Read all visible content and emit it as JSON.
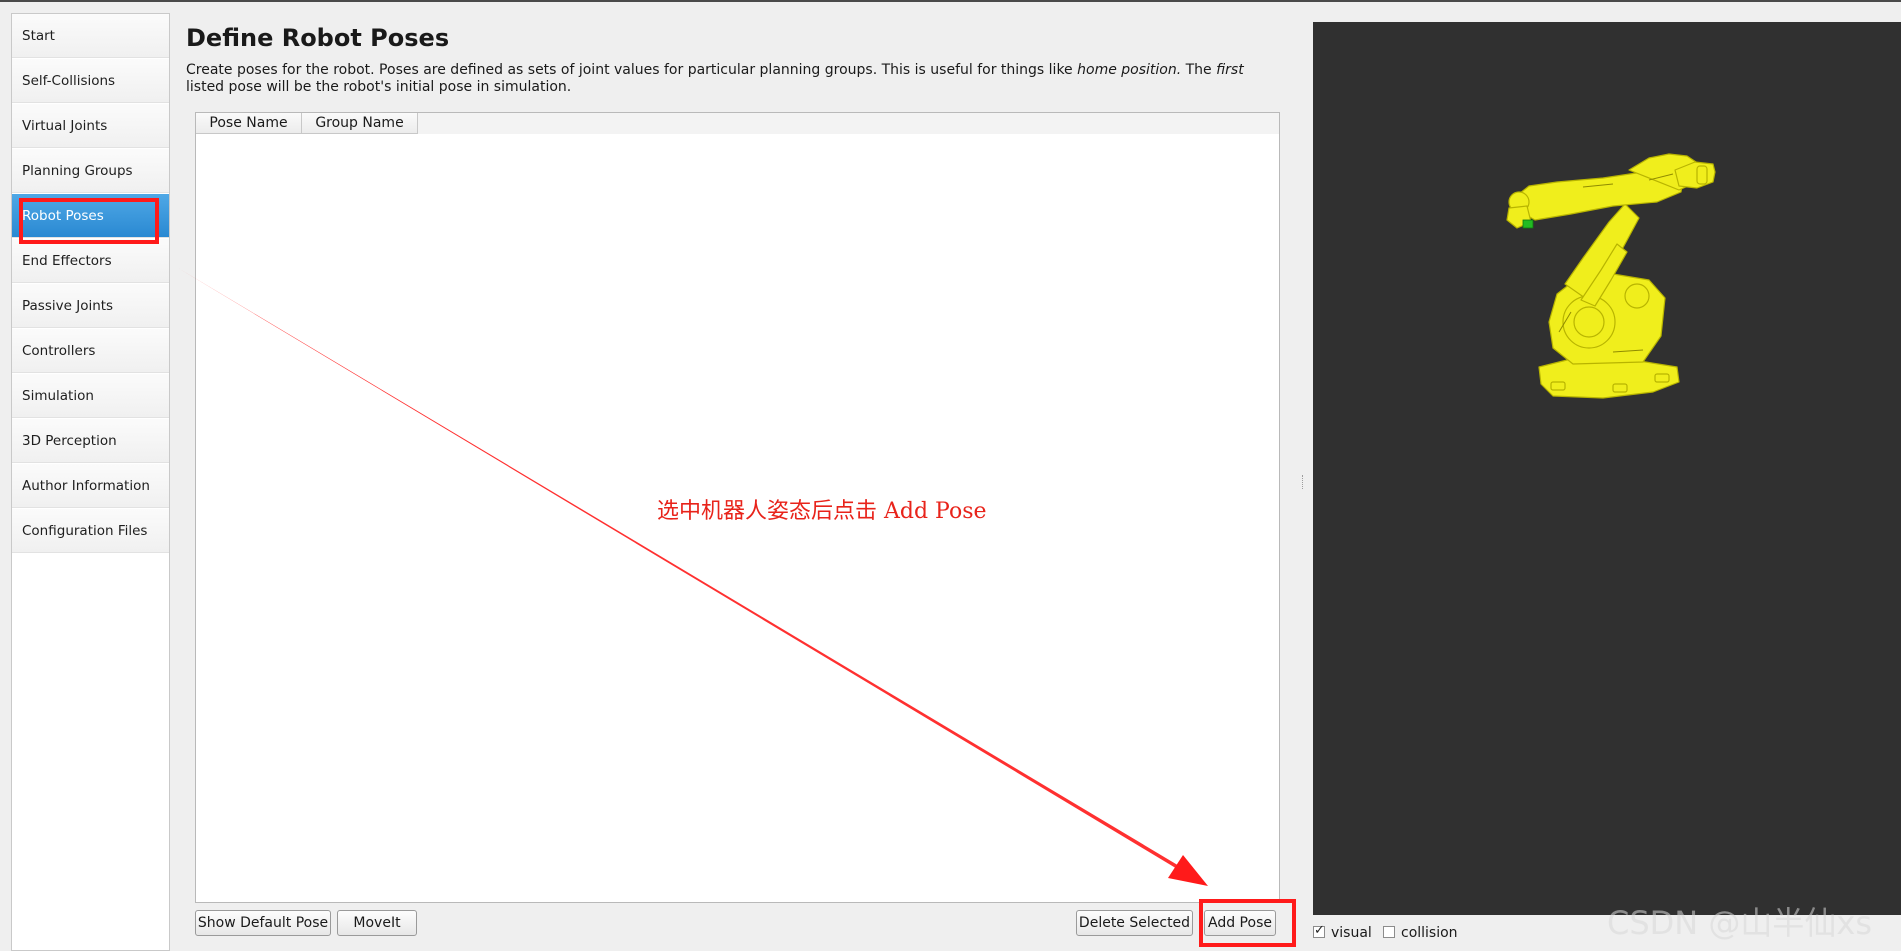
{
  "sidebar": {
    "items": [
      {
        "label": "Start"
      },
      {
        "label": "Self-Collisions"
      },
      {
        "label": "Virtual Joints"
      },
      {
        "label": "Planning Groups"
      },
      {
        "label": "Robot Poses",
        "active": true
      },
      {
        "label": "End Effectors"
      },
      {
        "label": "Passive Joints"
      },
      {
        "label": "Controllers"
      },
      {
        "label": "Simulation"
      },
      {
        "label": "3D Perception"
      },
      {
        "label": "Author Information"
      },
      {
        "label": "Configuration Files"
      }
    ]
  },
  "main": {
    "title": "Define Robot Poses",
    "description": {
      "part1": "Create poses for the robot. Poses are defined as sets of joint values for particular planning groups. This is useful for things like ",
      "em1": "home position.",
      "part2": " The ",
      "em2": "first",
      "part3": " listed pose will be the robot's initial pose in simulation."
    },
    "table": {
      "columns": [
        "Pose Name",
        "Group Name"
      ],
      "rows": []
    },
    "buttons": {
      "show_default_pose": "Show Default Pose",
      "moveit": "MoveIt",
      "delete_selected": "Delete Selected",
      "add_pose": "Add Pose"
    }
  },
  "viewer": {
    "visual_label": "visual",
    "visual_checked": true,
    "collision_label": "collision",
    "collision_checked": false
  },
  "annotation": {
    "text": "选中机器人姿态后点击 Add Pose",
    "color": "#ff1a1a"
  },
  "watermark": "CSDN @山半仙xs",
  "colors": {
    "active_item": "#2f8fd8",
    "viewer_bg": "#303030",
    "robot": "#f0ee1c"
  }
}
